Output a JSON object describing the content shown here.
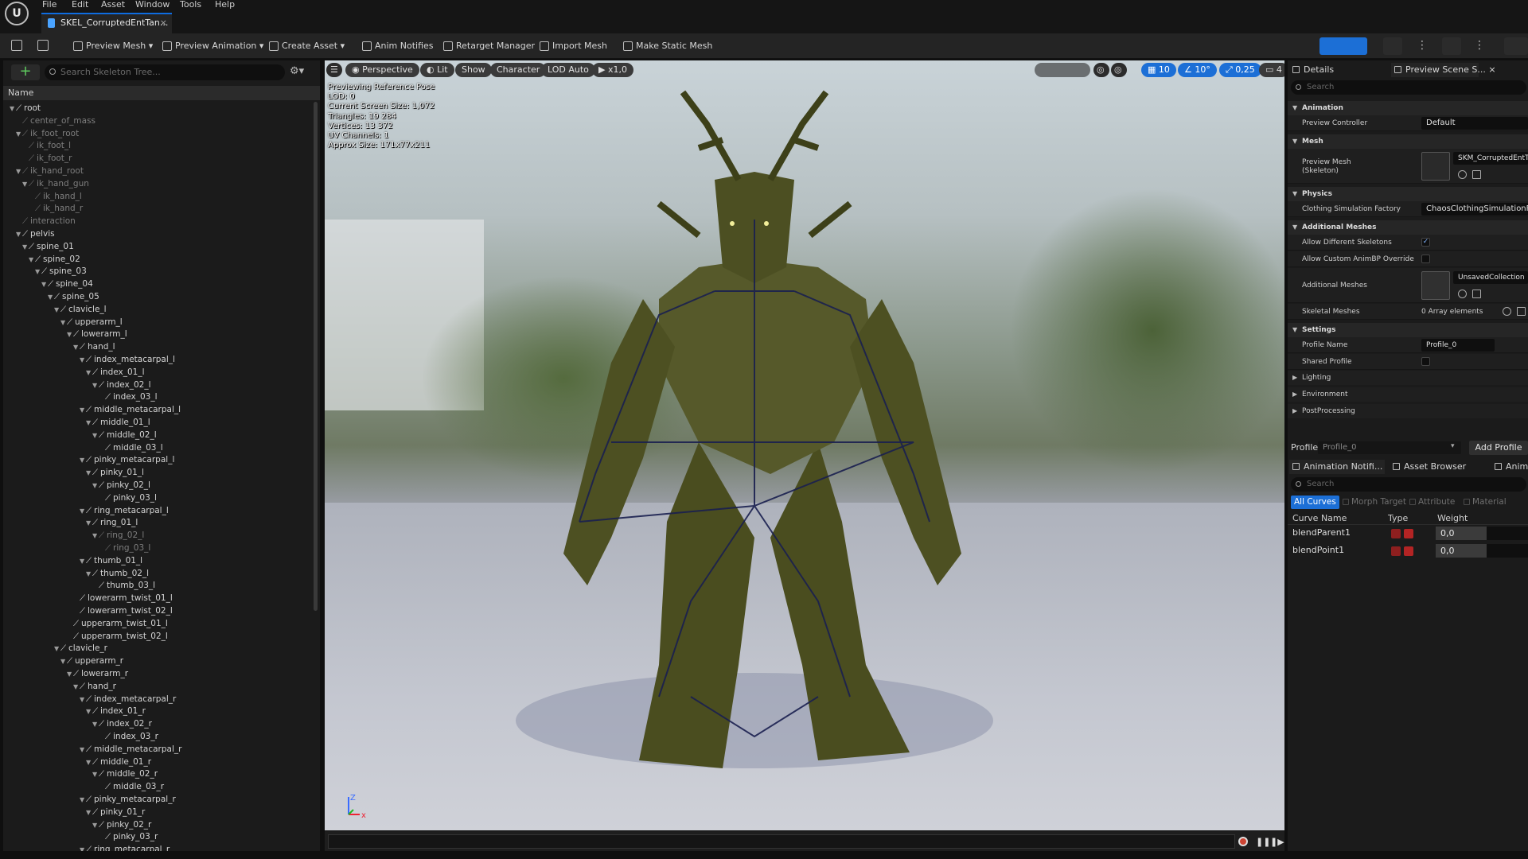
{
  "app": {
    "logo_text": "U"
  },
  "menu": [
    "File",
    "Edit",
    "Asset",
    "Window",
    "Tools",
    "Help"
  ],
  "tab": {
    "title": "SKEL_CorruptedEntTan...",
    "close": "×"
  },
  "toolbar": {
    "preview_mesh": "Preview Mesh",
    "preview_animation": "Preview Animation",
    "create_asset": "Create Asset",
    "anim_notifies": "Anim Notifies",
    "retarget_manager": "Retarget Manager",
    "import_mesh": "Import Mesh",
    "make_static_mesh": "Make Static Mesh"
  },
  "skeleton_tree": {
    "search_placeholder": "Search Skeleton Tree...",
    "column_name": "Name",
    "bones": [
      {
        "name": "root",
        "depth": 0,
        "dim": false,
        "expanded": true
      },
      {
        "name": "center_of_mass",
        "depth": 1,
        "dim": true,
        "expanded": null
      },
      {
        "name": "ik_foot_root",
        "depth": 1,
        "dim": true,
        "expanded": true
      },
      {
        "name": "ik_foot_l",
        "depth": 2,
        "dim": true,
        "expanded": null
      },
      {
        "name": "ik_foot_r",
        "depth": 2,
        "dim": true,
        "expanded": null
      },
      {
        "name": "ik_hand_root",
        "depth": 1,
        "dim": true,
        "expanded": true
      },
      {
        "name": "ik_hand_gun",
        "depth": 2,
        "dim": true,
        "expanded": true
      },
      {
        "name": "ik_hand_l",
        "depth": 3,
        "dim": true,
        "expanded": null
      },
      {
        "name": "ik_hand_r",
        "depth": 3,
        "dim": true,
        "expanded": null
      },
      {
        "name": "interaction",
        "depth": 1,
        "dim": true,
        "expanded": null
      },
      {
        "name": "pelvis",
        "depth": 1,
        "dim": false,
        "expanded": true
      },
      {
        "name": "spine_01",
        "depth": 2,
        "dim": false,
        "expanded": true
      },
      {
        "name": "spine_02",
        "depth": 3,
        "dim": false,
        "expanded": true
      },
      {
        "name": "spine_03",
        "depth": 4,
        "dim": false,
        "expanded": true
      },
      {
        "name": "spine_04",
        "depth": 5,
        "dim": false,
        "expanded": true
      },
      {
        "name": "spine_05",
        "depth": 6,
        "dim": false,
        "expanded": true
      },
      {
        "name": "clavicle_l",
        "depth": 7,
        "dim": false,
        "expanded": true
      },
      {
        "name": "upperarm_l",
        "depth": 8,
        "dim": false,
        "expanded": true
      },
      {
        "name": "lowerarm_l",
        "depth": 9,
        "dim": false,
        "expanded": true
      },
      {
        "name": "hand_l",
        "depth": 10,
        "dim": false,
        "expanded": true
      },
      {
        "name": "index_metacarpal_l",
        "depth": 11,
        "dim": false,
        "expanded": true
      },
      {
        "name": "index_01_l",
        "depth": 12,
        "dim": false,
        "expanded": true
      },
      {
        "name": "index_02_l",
        "depth": 13,
        "dim": false,
        "expanded": true
      },
      {
        "name": "index_03_l",
        "depth": 14,
        "dim": false,
        "expanded": null
      },
      {
        "name": "middle_metacarpal_l",
        "depth": 11,
        "dim": false,
        "expanded": true
      },
      {
        "name": "middle_01_l",
        "depth": 12,
        "dim": false,
        "expanded": true
      },
      {
        "name": "middle_02_l",
        "depth": 13,
        "dim": false,
        "expanded": true
      },
      {
        "name": "middle_03_l",
        "depth": 14,
        "dim": false,
        "expanded": null
      },
      {
        "name": "pinky_metacarpal_l",
        "depth": 11,
        "dim": false,
        "expanded": true
      },
      {
        "name": "pinky_01_l",
        "depth": 12,
        "dim": false,
        "expanded": true
      },
      {
        "name": "pinky_02_l",
        "depth": 13,
        "dim": false,
        "expanded": true
      },
      {
        "name": "pinky_03_l",
        "depth": 14,
        "dim": false,
        "expanded": null
      },
      {
        "name": "ring_metacarpal_l",
        "depth": 11,
        "dim": false,
        "expanded": true
      },
      {
        "name": "ring_01_l",
        "depth": 12,
        "dim": false,
        "expanded": true
      },
      {
        "name": "ring_02_l",
        "depth": 13,
        "dim": true,
        "expanded": true
      },
      {
        "name": "ring_03_l",
        "depth": 14,
        "dim": true,
        "expanded": null
      },
      {
        "name": "thumb_01_l",
        "depth": 11,
        "dim": false,
        "expanded": true
      },
      {
        "name": "thumb_02_l",
        "depth": 12,
        "dim": false,
        "expanded": true
      },
      {
        "name": "thumb_03_l",
        "depth": 13,
        "dim": false,
        "expanded": null
      },
      {
        "name": "lowerarm_twist_01_l",
        "depth": 10,
        "dim": false,
        "expanded": null
      },
      {
        "name": "lowerarm_twist_02_l",
        "depth": 10,
        "dim": false,
        "expanded": null
      },
      {
        "name": "upperarm_twist_01_l",
        "depth": 9,
        "dim": false,
        "expanded": null
      },
      {
        "name": "upperarm_twist_02_l",
        "depth": 9,
        "dim": false,
        "expanded": null
      },
      {
        "name": "clavicle_r",
        "depth": 7,
        "dim": false,
        "expanded": true
      },
      {
        "name": "upperarm_r",
        "depth": 8,
        "dim": false,
        "expanded": true
      },
      {
        "name": "lowerarm_r",
        "depth": 9,
        "dim": false,
        "expanded": true
      },
      {
        "name": "hand_r",
        "depth": 10,
        "dim": false,
        "expanded": true
      },
      {
        "name": "index_metacarpal_r",
        "depth": 11,
        "dim": false,
        "expanded": true
      },
      {
        "name": "index_01_r",
        "depth": 12,
        "dim": false,
        "expanded": true
      },
      {
        "name": "index_02_r",
        "depth": 13,
        "dim": false,
        "expanded": true
      },
      {
        "name": "index_03_r",
        "depth": 14,
        "dim": false,
        "expanded": null
      },
      {
        "name": "middle_metacarpal_r",
        "depth": 11,
        "dim": false,
        "expanded": true
      },
      {
        "name": "middle_01_r",
        "depth": 12,
        "dim": false,
        "expanded": true
      },
      {
        "name": "middle_02_r",
        "depth": 13,
        "dim": false,
        "expanded": true
      },
      {
        "name": "middle_03_r",
        "depth": 14,
        "dim": false,
        "expanded": null
      },
      {
        "name": "pinky_metacarpal_r",
        "depth": 11,
        "dim": false,
        "expanded": true
      },
      {
        "name": "pinky_01_r",
        "depth": 12,
        "dim": false,
        "expanded": true
      },
      {
        "name": "pinky_02_r",
        "depth": 13,
        "dim": false,
        "expanded": true
      },
      {
        "name": "pinky_03_r",
        "depth": 14,
        "dim": false,
        "expanded": null
      },
      {
        "name": "ring_metacarpal_r",
        "depth": 11,
        "dim": false,
        "expanded": true
      }
    ]
  },
  "viewport": {
    "perspective": "Perspective",
    "lit": "Lit",
    "show": "Show",
    "character": "Character",
    "lod": "LOD Auto",
    "play_rate": "x1,0",
    "grid_snap": "10",
    "rot_snap": "10°",
    "scale_snap": "0,25",
    "cam_speed": "4",
    "stats": [
      "Previewing Reference Pose",
      "LOD: 0",
      "Current Screen Size: 1,072",
      "Triangles: 19 284",
      "Vertices: 13 372",
      "UV Channels: 1",
      "Approx Size: 171x77x211"
    ],
    "axis_z": "Z",
    "axis_x": "x"
  },
  "details": {
    "tab_details": "Details",
    "tab_preview_scene": "Preview Scene S...",
    "close": "×",
    "search_placeholder": "Search",
    "animation_cat": "Animation",
    "preview_controller_label": "Preview Controller",
    "preview_controller_value": "Default",
    "mesh_cat": "Mesh",
    "preview_mesh_label": "Preview Mesh\n(Skeleton)",
    "preview_mesh_value": "SKM_CorruptedEntTan",
    "physics_cat": "Physics",
    "clothing_label": "Clothing Simulation Factory",
    "clothing_value": "ChaosClothingSimulationFa",
    "additional_meshes_cat": "Additional Meshes",
    "allow_diff_skel_label": "Allow Different Skeletons",
    "allow_diff_skel_checked": true,
    "allow_custom_animbp_label": "Allow Custom AnimBP Override",
    "allow_custom_animbp_checked": false,
    "additional_meshes_label": "Additional Meshes",
    "additional_meshes_value": "UnsavedCollection",
    "skeletal_meshes_label": "Skeletal Meshes",
    "skeletal_meshes_value": "0 Array elements",
    "settings_cat": "Settings",
    "profile_name_label": "Profile Name",
    "profile_name_value": "Profile_0",
    "shared_profile_label": "Shared Profile",
    "shared_profile_checked": false,
    "lighting": "Lighting",
    "environment": "Environment",
    "postprocessing": "PostProcessing",
    "profile_label": "Profile",
    "profile_select": "Profile_0",
    "add_profile": "Add Profile"
  },
  "curves": {
    "tab_anim_notifies": "Animation Notifi...",
    "tab_asset_browser": "Asset Browser",
    "tab_anim": "Anim",
    "search_placeholder": "Search",
    "filters": [
      "All Curves",
      "Morph Target",
      "Attribute",
      "Material"
    ],
    "col_curve_name": "Curve Name",
    "col_type": "Type",
    "col_weight": "Weight",
    "rows": [
      {
        "name": "blendParent1",
        "weight": "0,0"
      },
      {
        "name": "blendPoint1",
        "weight": "0,0"
      }
    ]
  },
  "colors": {
    "accent": "#1c6fd6",
    "panel": "#1b1b1b",
    "toolbar": "#242424"
  }
}
